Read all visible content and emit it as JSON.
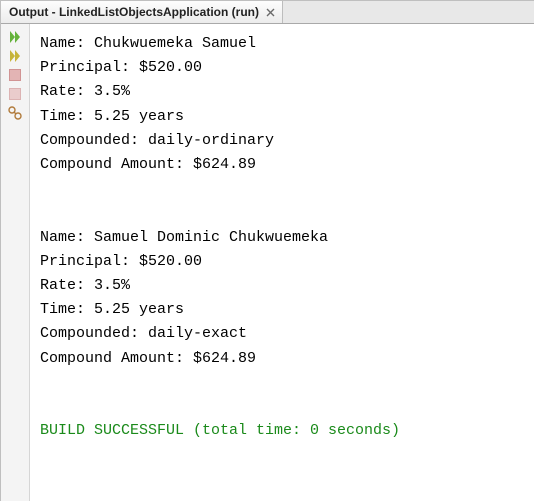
{
  "tab": {
    "title": "Output - LinkedListObjectsApplication (run)"
  },
  "blocks": [
    {
      "l0": "Name: Chukwuemeka Samuel",
      "l1": "Principal: $520.00",
      "l2": "Rate: 3.5%",
      "l3": "Time: 5.25 years",
      "l4": "Compounded: daily-ordinary",
      "l5": "Compound Amount: $624.89"
    },
    {
      "l0": "Name: Samuel Dominic Chukwuemeka",
      "l1": "Principal: $520.00",
      "l2": "Rate: 3.5%",
      "l3": "Time: 5.25 years",
      "l4": "Compounded: daily-exact",
      "l5": "Compound Amount: $624.89"
    }
  ],
  "status": "BUILD SUCCESSFUL (total time: 0 seconds)"
}
